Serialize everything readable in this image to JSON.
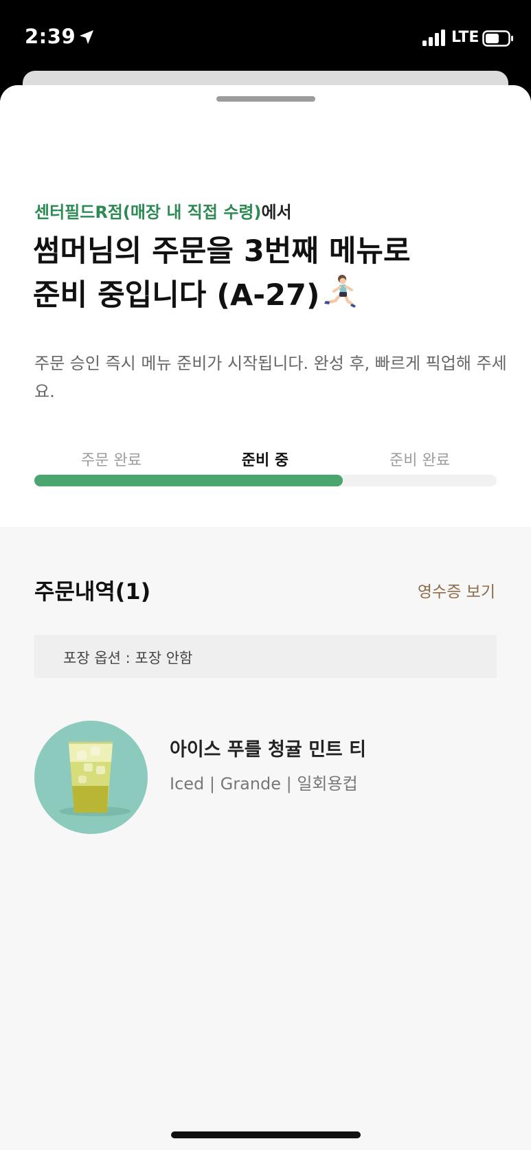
{
  "status_bar": {
    "time": "2:39",
    "network": "LTE"
  },
  "order": {
    "store_name": "센터필드R점(매장 내 직접 수령)",
    "store_suffix": "에서",
    "headline_line1": "썸머님의 주문을 3번째 메뉴로",
    "headline_line2": "준비 중입니다 (A-27)",
    "description": "주문 승인 즉시 메뉴 준비가 시작됩니다. 완성 후, 빠르게 픽업해 주세요."
  },
  "progress": {
    "steps": [
      "주문 완료",
      "준비 중",
      "준비 완료"
    ],
    "active_index": 1,
    "fraction": 0.667
  },
  "history": {
    "title": "주문내역(1)",
    "receipt_link": "영수증 보기",
    "packaging_option": "포장 옵션 : 포장 안함",
    "items": [
      {
        "name": "아이스 푸를 청귤 민트 티",
        "options": "Iced | Grande | 일회용컵"
      }
    ]
  },
  "colors": {
    "brand_green": "#2e8a54",
    "progress_green": "#4aa66e",
    "receipt_brown": "#8e6b4a",
    "thumb_bg": "#8ccabe"
  },
  "icons": [
    "location-arrow-icon",
    "signal-icon",
    "battery-icon",
    "runner-emoji-icon"
  ]
}
